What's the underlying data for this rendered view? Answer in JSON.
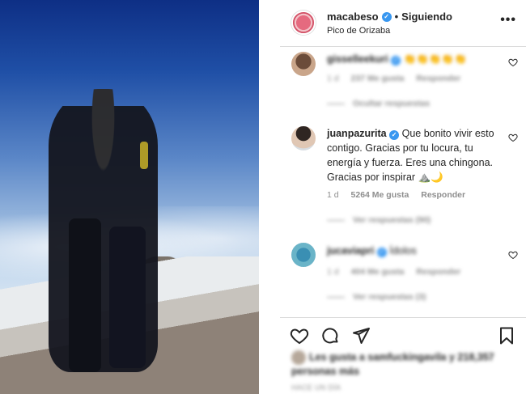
{
  "post": {
    "username": "macabeso",
    "following_label": "Siguiendo",
    "location": "Pico de Orizaba",
    "more_glyph": "•••"
  },
  "comments": [
    {
      "username": "gisselleekuri",
      "text": "👏👏👏👏👏",
      "age": "1 d",
      "likes": "237 Me gusta",
      "reply_label": "Responder",
      "replies_label": "Ocultar respuestas",
      "blurred": true
    },
    {
      "username": "juanpazurita",
      "text": "Que bonito vivir esto contigo. Gracias por tu locura, tu energía y fuerza. Eres una chingona. Gracias por inspirar ⛰️🌙",
      "age": "1 d",
      "likes": "5264 Me gusta",
      "reply_label": "Responder",
      "replies_label": "Ver respuestas (90)",
      "blurred": false
    },
    {
      "username": "jucaviapri",
      "text": "Ídolos",
      "age": "1 d",
      "likes": "404 Me gusta",
      "reply_label": "Responder",
      "replies_label": "Ver respuestas (3)",
      "blurred": true
    }
  ],
  "likes_text": "Les gusta a samfuckingavila y 218,357 personas más",
  "date_text": "HACE UN DÍA",
  "colors": {
    "verified": "#3897f0",
    "meta": "#8e8e8e",
    "text": "#262626"
  }
}
